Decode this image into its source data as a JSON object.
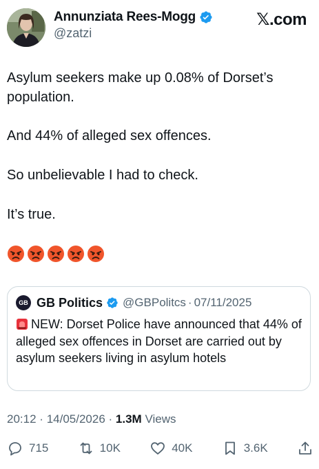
{
  "header": {
    "display_name": "Annunziata Rees-Mogg",
    "handle": "@zatzi",
    "brand": "𝕏.com"
  },
  "tweet": {
    "paragraphs": [
      "Asylum seekers make up 0.08% of Dorset’s population.",
      "And 44% of alleged sex offences.",
      "So unbelievable I had to check.",
      "It’s true."
    ],
    "emoji": [
      "angry-face",
      "angry-face",
      "angry-face",
      "angry-face",
      "angry-face"
    ]
  },
  "quote": {
    "avatar_text": "GB",
    "name": "GB Politics",
    "handle": "@GBPolitcs",
    "separator": "·",
    "date": "07/11/2025",
    "text": "NEW: Dorset Police have announced that 44% of alleged sex offences in Dorset are carried out by asylum seekers living in asylum hotels"
  },
  "meta": {
    "time": "20:12",
    "separator": "·",
    "date": "14/05/2026",
    "views_count": "1.3M",
    "views_label": "Views"
  },
  "actions": {
    "replies": "715",
    "reposts": "10K",
    "likes": "40K",
    "bookmarks": "3.6K"
  },
  "colors": {
    "verified": "#1d9bf0",
    "text": "#0f1419",
    "secondary": "#536471",
    "border": "#cfd9de"
  }
}
